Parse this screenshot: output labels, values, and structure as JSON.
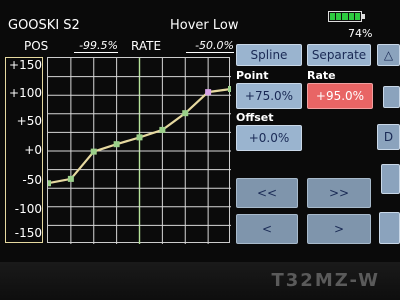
{
  "header": {
    "model_name": "GOOSKI S2",
    "condition": "Hover Low",
    "battery_percent": "74%"
  },
  "readouts": {
    "pos_label": "POS",
    "pos_value": "-99.5%",
    "rate_label": "RATE",
    "rate_value": "-50.0%"
  },
  "y_axis_ticks": [
    "+150",
    "+100",
    "+50",
    "+0",
    "-50",
    "-100",
    "-150"
  ],
  "controls": {
    "spline_label": "Spline",
    "separate_label": "Separate",
    "point_label": "Point",
    "point_value": "+75.0%",
    "rate_label": "Rate",
    "rate_value": "+95.0%",
    "offset_label": "Offset",
    "offset_value": "+0.0%",
    "first_point_label": "<<",
    "last_point_label": ">>",
    "prev_point_label": "<",
    "next_point_label": ">",
    "edge_up_label": "△",
    "edge_d_label": "D"
  },
  "chart_data": {
    "type": "line",
    "x": [
      -100,
      -75,
      -50,
      -25,
      0,
      25,
      50,
      75,
      100
    ],
    "values": [
      -52,
      -45,
      -1,
      11,
      22,
      34,
      61,
      95,
      100
    ],
    "ylim": [
      -150,
      150
    ],
    "xlim": [
      -100,
      100
    ],
    "grid": true,
    "selected_point_index": 7,
    "colors": {
      "curve": "#e6d9a0",
      "point": "#9bd08a",
      "selected_point": "#d6a4e6",
      "grid": "#d8d8d8",
      "center_line": "#b6e39a"
    }
  },
  "brand": "T32MZ-W"
}
